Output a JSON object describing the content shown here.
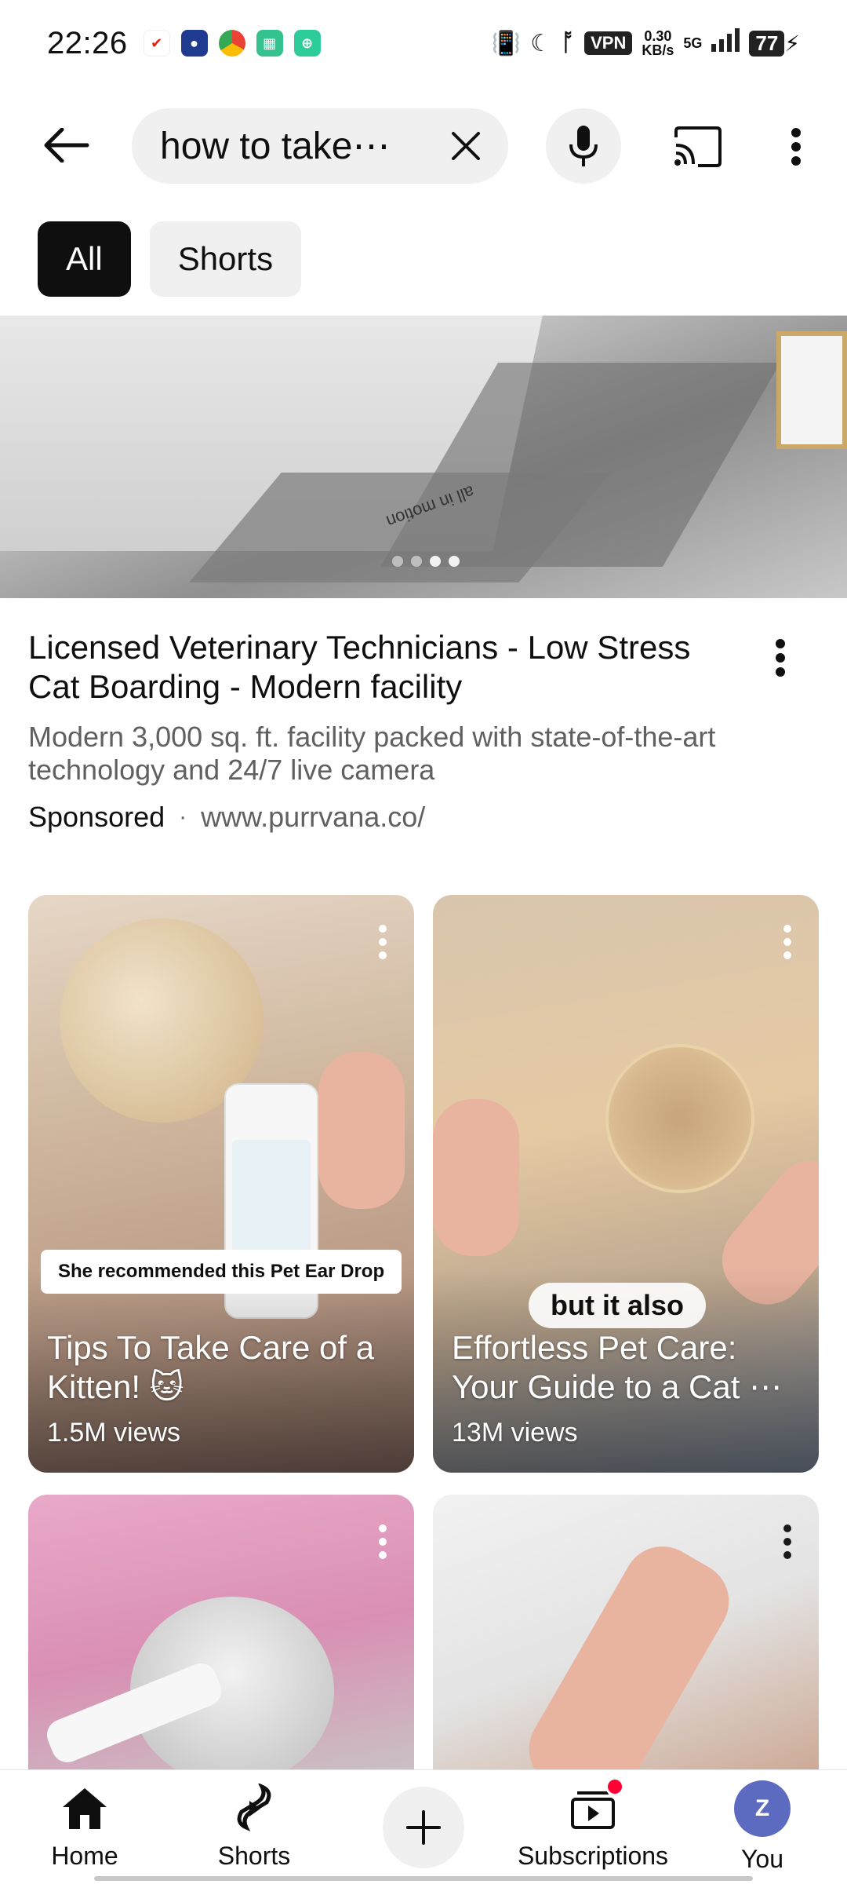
{
  "status_bar": {
    "time": "22:26",
    "vpn": "VPN",
    "speed_value": "0.30",
    "speed_unit": "KB/s",
    "network": "5G",
    "battery": "77"
  },
  "search": {
    "query": "how to take⋯",
    "back_icon": "arrow-left-icon",
    "clear_icon": "close-icon",
    "mic_icon": "mic-icon",
    "cast_icon": "cast-icon",
    "more_icon": "more-vert-icon"
  },
  "chips": [
    {
      "label": "All",
      "active": true
    },
    {
      "label": "Shorts",
      "active": false
    }
  ],
  "ad": {
    "title": "Licensed Veterinary Technicians - Low Stress Cat Boarding - Modern facility",
    "description": "Modern 3,000 sq. ft. facility packed with state-of-the-art technology and 24/7 live camera",
    "sponsored": "Sponsored",
    "separator": "·",
    "url": "www.purrvana.co/",
    "mat_text": "all in motion"
  },
  "shorts": [
    {
      "title": "Tips To Take Care of a Kitten! 🐱",
      "views": "1.5M views",
      "overlay": "She recommended this Pet Ear Drop"
    },
    {
      "title": "Effortless Pet Care: Your Guide to a Cat ⋯",
      "views": "13M views",
      "overlay": "but it also"
    },
    {
      "title": "",
      "views": ""
    },
    {
      "title": "",
      "views": ""
    }
  ],
  "nav": {
    "home": "Home",
    "shorts": "Shorts",
    "subscriptions": "Subscriptions",
    "you": "You",
    "avatar_letter": "Z"
  },
  "colors": {
    "accent_red": "#ff0033",
    "avatar_bg": "#5c6bc0",
    "chip_active": "#0f0f0f",
    "chip_inactive": "#f0f0f0"
  }
}
